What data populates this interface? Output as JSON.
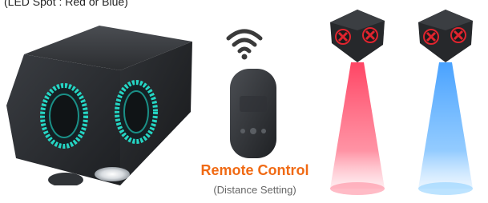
{
  "header": {
    "product_note": "(LED Spot : Red or Blue)"
  },
  "remote": {
    "title": "Remote Control",
    "subtitle": "(Distance Setting)"
  },
  "colors": {
    "accent_orange": "#f06a14",
    "ring_teal": "#25d6c4",
    "beam_red": "#ff3b5c",
    "beam_blue": "#3f9dff",
    "cross_red": "#e0242e",
    "device_dark": "#26282b"
  },
  "icons": {
    "wifi": "wifi-icon",
    "remote": "remote-control-icon",
    "device": "led-device-icon"
  }
}
